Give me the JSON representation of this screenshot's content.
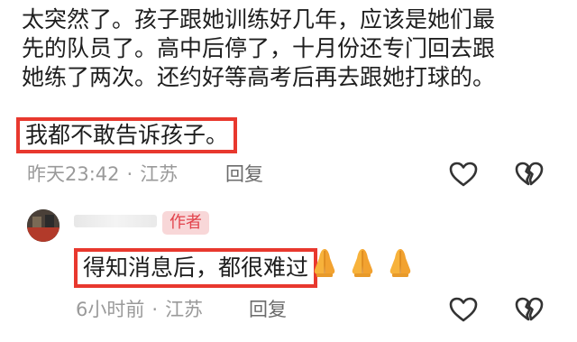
{
  "comment": {
    "lines": [
      "太突然了。孩子跟她训练好几年，应该是她们最",
      "先的队员了。高中后停了，十月份还专门回去跟",
      "她练了两次。还约好等高考后再去跟她打球的。"
    ],
    "highlight": "我都不敢告诉孩子。",
    "time": "昨天23:42",
    "location": "江苏",
    "reply_label": "回复",
    "like_icon": "heart-outline-icon",
    "dislike_icon": "broken-heart-icon"
  },
  "reply": {
    "author_badge": "作者",
    "text": "得知消息后，都很难过",
    "emoji_icon": "folded-hands-icon",
    "emoji_count": 3,
    "time": "6小时前",
    "location": "江苏",
    "reply_label": "回复",
    "like_icon": "heart-outline-icon",
    "dislike_icon": "broken-heart-icon"
  },
  "colors": {
    "highlight_border": "#e8382e",
    "badge_bg": "#f8d7d8",
    "badge_text": "#e2434c",
    "meta_text": "#9a9a9a"
  }
}
